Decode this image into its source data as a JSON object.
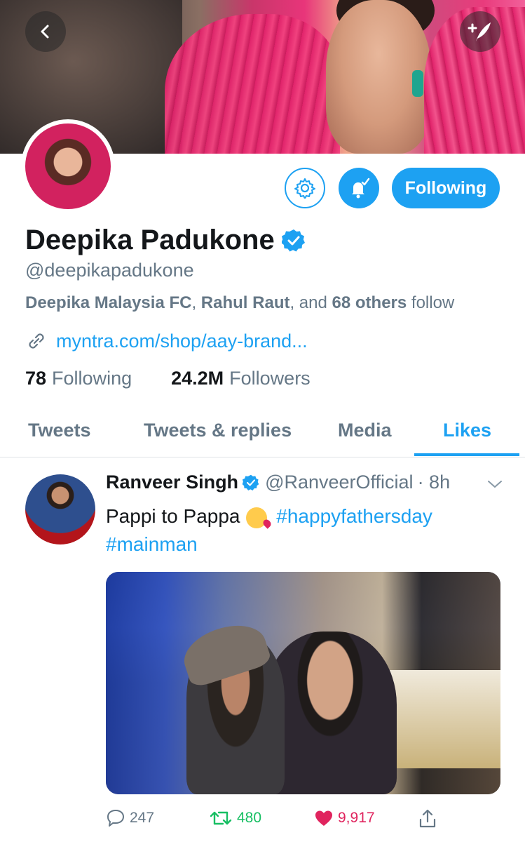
{
  "profile": {
    "name": "Deepika Padukone",
    "handle": "@deepikapadukone",
    "followed_by": {
      "name1": "Deepika Malaysia FC",
      "sep1": ", ",
      "name2": "Rahul Raut",
      "sep2": ", and ",
      "others": "68 others",
      "suffix": " follow"
    },
    "link": "myntra.com/shop/aay-brand...",
    "following_count": "78",
    "following_label": "Following",
    "followers_count": "24.2M",
    "followers_label": "Followers",
    "follow_button_label": "Following"
  },
  "tabs": [
    "Tweets",
    "Tweets & replies",
    "Media",
    "Likes"
  ],
  "active_tab": "Likes",
  "tweet": {
    "author_name": "Ranveer Singh",
    "author_handle": "@RanveerOfficial",
    "time": "· 8h",
    "text_before": "Pappi to Pappa",
    "hashtag1": "#happyfathersday",
    "hashtag2": "#mainman",
    "reply_count": "247",
    "retweet_count": "480",
    "like_count": "9,917"
  },
  "icons": {
    "back": "chevron-left-icon",
    "compose": "compose-tweet-icon",
    "settings": "gear-icon",
    "notifications": "bell-check-icon",
    "verified": "verified-badge-icon",
    "link": "link-icon",
    "caret": "chevron-down-icon",
    "reply": "reply-icon",
    "retweet": "retweet-icon",
    "like": "heart-icon",
    "share": "share-icon"
  },
  "colors": {
    "accent": "#1da1f2",
    "muted_text": "#657786",
    "retweet": "#17bf63",
    "like": "#e0245e"
  }
}
